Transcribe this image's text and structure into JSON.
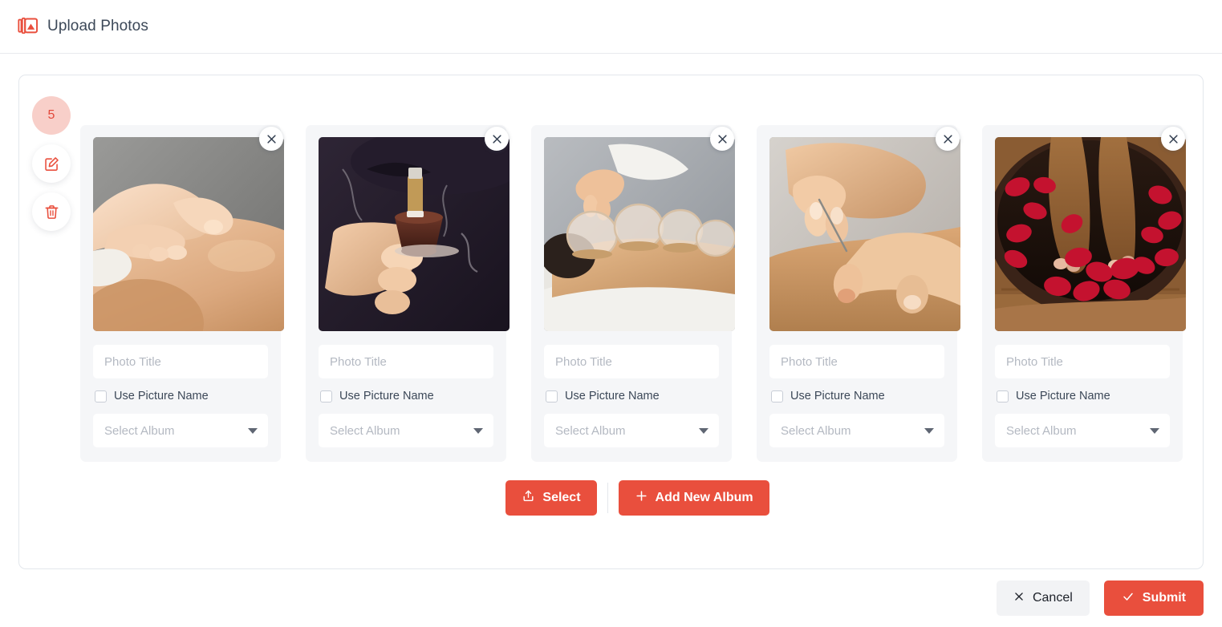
{
  "header": {
    "title": "Upload Photos",
    "icon": "image-stack-icon"
  },
  "rail": {
    "count": "5",
    "edit_icon": "edit-square-icon",
    "delete_icon": "trash-icon"
  },
  "theme": {
    "accent": "#e94f3d",
    "badge_bg": "#f8cfc9",
    "badge_text": "#e2483a",
    "card_bg": "#f5f6f8",
    "text": "#3c4858",
    "placeholder": "#b4b9c2"
  },
  "cards": [
    {
      "close_icon": "close-icon",
      "title_value": "",
      "title_placeholder": "Photo Title",
      "checkbox_label": "Use Picture Name",
      "checkbox_checked": false,
      "album_value": "",
      "album_placeholder": "Select Album",
      "photo_alt": "massage-therapy-hands-on-back"
    },
    {
      "close_icon": "close-icon",
      "title_value": "",
      "title_placeholder": "Photo Title",
      "checkbox_label": "Use Picture Name",
      "checkbox_checked": false,
      "album_value": "",
      "album_placeholder": "Select Album",
      "photo_alt": "moxibustion-moxa-stick-in-hand"
    },
    {
      "close_icon": "close-icon",
      "title_value": "",
      "title_placeholder": "Photo Title",
      "checkbox_label": "Use Picture Name",
      "checkbox_checked": false,
      "album_value": "",
      "album_placeholder": "Select Album",
      "photo_alt": "cupping-therapy-glass-cups-on-back"
    },
    {
      "close_icon": "close-icon",
      "title_value": "",
      "title_placeholder": "Photo Title",
      "checkbox_label": "Use Picture Name",
      "checkbox_checked": false,
      "album_value": "",
      "album_placeholder": "Select Album",
      "photo_alt": "acupuncture-needle-insertion"
    },
    {
      "close_icon": "close-icon",
      "title_value": "",
      "title_placeholder": "Photo Title",
      "checkbox_label": "Use Picture Name",
      "checkbox_checked": false,
      "album_value": "",
      "album_placeholder": "Select Album",
      "photo_alt": "foot-bath-with-rose-petals"
    }
  ],
  "album_actions": {
    "select_label": "Select",
    "select_icon": "upload-icon",
    "add_album_label": "Add New Album",
    "add_album_icon": "plus-icon"
  },
  "footer": {
    "cancel_label": "Cancel",
    "cancel_icon": "close-icon",
    "submit_label": "Submit",
    "submit_icon": "check-icon"
  }
}
